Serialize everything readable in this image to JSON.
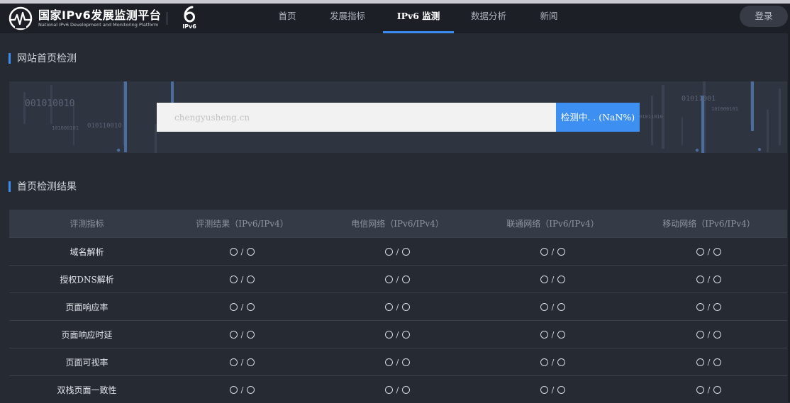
{
  "header": {
    "brand_title": "国家IPv6发展监测平台",
    "brand_subtitle": "National IPv6 Development and Monitoring Platform",
    "ipv6_badge": "IPv6",
    "nav": [
      {
        "label": "首页",
        "active": false
      },
      {
        "label": "发展指标",
        "active": false
      },
      {
        "label": "IPv6 监测",
        "active": true
      },
      {
        "label": "数据分析",
        "active": false
      },
      {
        "label": "新闻",
        "active": false
      }
    ],
    "login_label": "登录"
  },
  "detect": {
    "section_title": "网站首页检测",
    "input_value": "chengyusheng.cn",
    "button_label": "检测中. . (NaN%)",
    "banner_texts": [
      "001010010",
      "101000101",
      "010110010",
      "01011001",
      "101000101",
      "01011010"
    ]
  },
  "results": {
    "section_title": "首页检测结果",
    "columns": [
      "评测指标",
      "评测结果（IPv6/IPv4）",
      "电信网络（IPv6/IPv4）",
      "联通网络（IPv6/IPv4）",
      "移动网络（IPv6/IPv4）"
    ],
    "rows": [
      {
        "label": "域名解析"
      },
      {
        "label": "授权DNS解析"
      },
      {
        "label": "页面响应率"
      },
      {
        "label": "页面响应时延"
      },
      {
        "label": "页面可视率"
      },
      {
        "label": "双栈页面一致性"
      }
    ],
    "separator": "/"
  },
  "colors": {
    "accent": "#3b8cf0",
    "background": "#262a33",
    "header_bg": "#1c1f26"
  }
}
